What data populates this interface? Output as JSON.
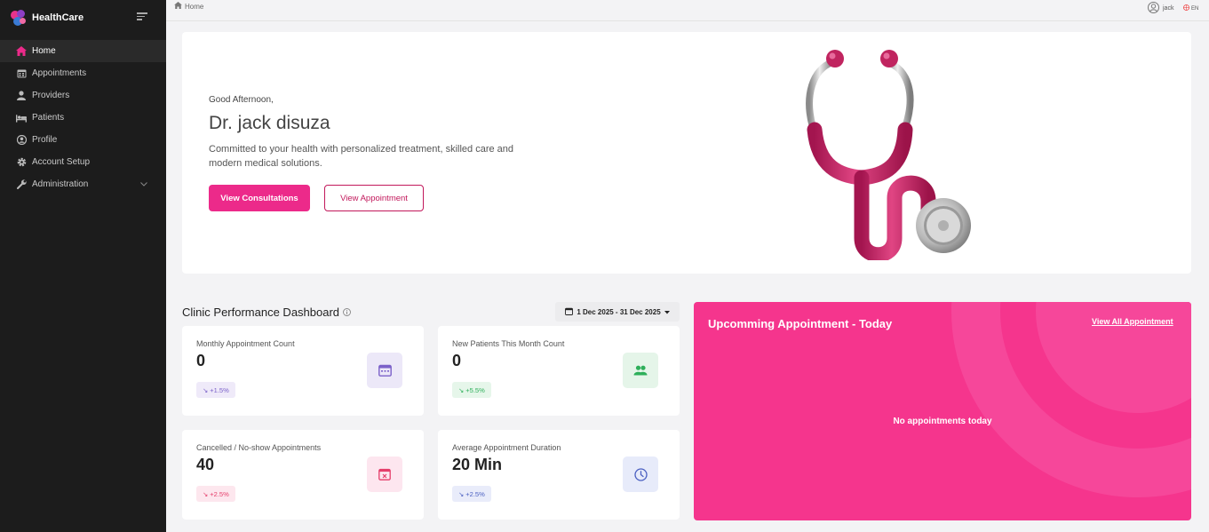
{
  "app": {
    "name": "HealthCare"
  },
  "sidebar": {
    "items": [
      {
        "label": "Home",
        "icon": "home-icon",
        "active": true
      },
      {
        "label": "Appointments",
        "icon": "calendar-icon"
      },
      {
        "label": "Providers",
        "icon": "user-icon"
      },
      {
        "label": "Patients",
        "icon": "bed-icon"
      },
      {
        "label": "Profile",
        "icon": "user-circle-icon"
      },
      {
        "label": "Account Setup",
        "icon": "gear-icon"
      },
      {
        "label": "Administration",
        "icon": "wrench-icon"
      }
    ]
  },
  "topbar": {
    "breadcrumb": "Home",
    "user": "jack",
    "language": "EN"
  },
  "hero": {
    "greeting": "Good Afternoon,",
    "name": "Dr. jack disuza",
    "tagline": "Committed to your health with personalized treatment, skilled care and modern medical solutions.",
    "primary_button": "View Consultations",
    "secondary_button": "View Appointment"
  },
  "dashboard": {
    "title": "Clinic Performance Dashboard",
    "date_range": "1 Dec 2025 - 31 Dec 2025",
    "cards": [
      {
        "label": "Monthly Appointment Count",
        "value": "0",
        "change": "+1.5%",
        "icon": "calendar-icon",
        "accent": "#7b61c9"
      },
      {
        "label": "New Patients This Month Count",
        "value": "0",
        "change": "+5.5%",
        "icon": "users-icon",
        "accent": "#2eaf5a"
      },
      {
        "label": "Cancelled / No-show Appointments",
        "value": "40",
        "change": "+2.5%",
        "icon": "calendar-x-icon",
        "accent": "#e53e6b"
      },
      {
        "label": "Average Appointment Duration",
        "value": "20 Min",
        "change": "+2.5%",
        "icon": "clock-icon",
        "accent": "#4a5fc1"
      }
    ]
  },
  "upcoming": {
    "title": "Upcomming Appointment - Today",
    "link": "View All Appointment",
    "empty": "No appointments today"
  },
  "colors": {
    "brand": "#ec2a8a",
    "upcoming_bg": "#f5358d",
    "sidebar_bg": "#1c1c1c"
  }
}
